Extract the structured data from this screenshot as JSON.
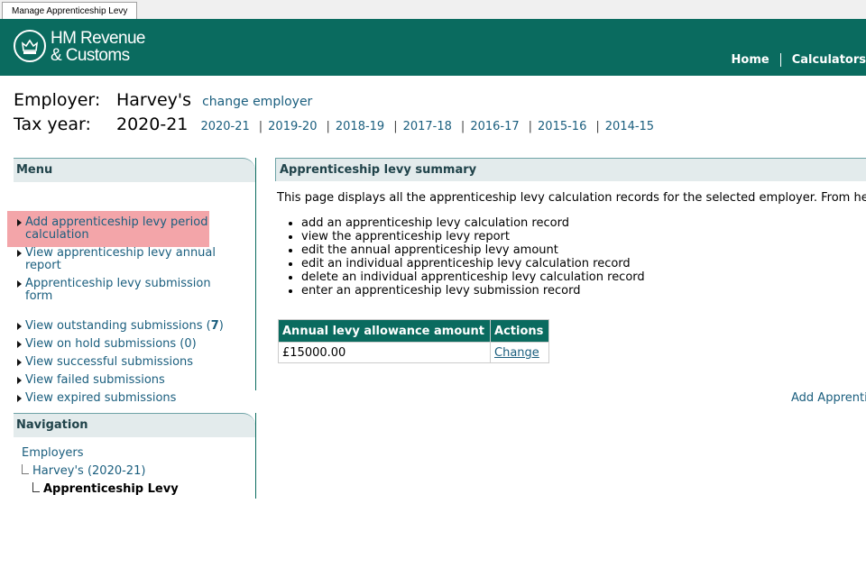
{
  "window": {
    "tab_title": "Manage Apprenticeship Levy"
  },
  "header": {
    "logo_line1": "HM Revenue",
    "logo_line2": "& Customs",
    "nav": [
      "Home",
      "Calculators"
    ]
  },
  "employer": {
    "label": "Employer:",
    "name": "Harvey's",
    "change_link": "change employer"
  },
  "tax_year": {
    "label": "Tax year:",
    "current": "2020-21",
    "years": [
      "2020-21",
      "2019-20",
      "2018-19",
      "2017-18",
      "2016-17",
      "2015-16",
      "2014-15"
    ]
  },
  "menu": {
    "title": "Menu",
    "items": [
      "Add apprenticeship levy period calculation",
      "View apprenticeship levy annual report",
      "Apprenticeship levy submission form"
    ],
    "submissions": [
      {
        "label": "View outstanding submissions (",
        "count": "7",
        "suffix": ")"
      },
      {
        "label": "View on hold submissions (0)"
      },
      {
        "label": "View successful submissions"
      },
      {
        "label": "View failed submissions"
      },
      {
        "label": "View expired submissions"
      }
    ]
  },
  "navigation": {
    "title": "Navigation",
    "level1": "Employers",
    "level2": "Harvey's (2020-21)",
    "level3": "Apprenticeship Levy"
  },
  "main": {
    "title": "Apprenticeship levy summary",
    "description": "This page displays all the apprenticeship levy calculation records for the selected employer. From here y",
    "tasks": [
      "add an apprenticeship levy calculation record",
      "view the apprenticeship levy report",
      "edit the annual apprenticeship levy amount",
      "edit an individual apprenticeship levy calculation record",
      "delete an individual apprenticeship levy calculation record",
      "enter an apprenticeship levy submission record"
    ],
    "table": {
      "headers": [
        "Annual levy allowance amount",
        "Actions"
      ],
      "row": {
        "amount": "£15000.00",
        "action": "Change"
      }
    },
    "add_link": "Add Apprenti"
  },
  "colors": {
    "brand": "#0a6b5f",
    "link": "#1a5e7e",
    "highlight": "#f3a5a9"
  }
}
